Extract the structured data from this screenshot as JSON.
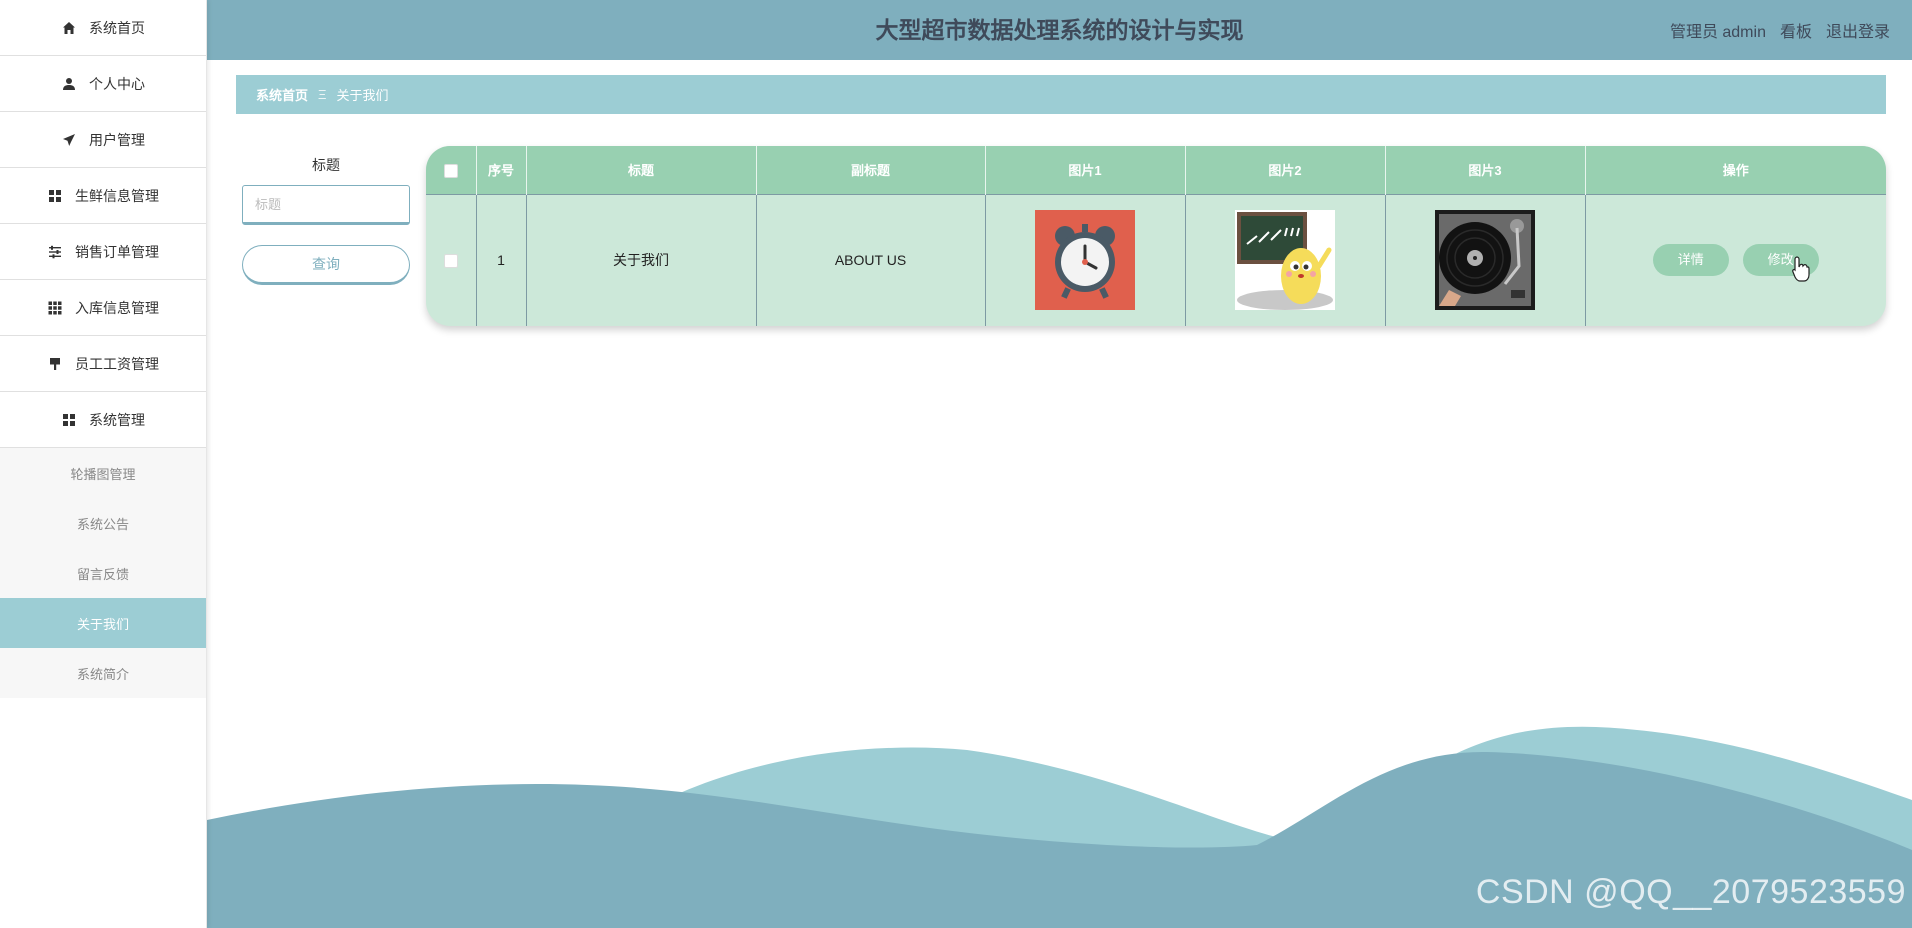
{
  "sidebar": {
    "items": [
      {
        "label": "系统首页",
        "icon": "home-icon"
      },
      {
        "label": "个人中心",
        "icon": "user-icon"
      },
      {
        "label": "用户管理",
        "icon": "send-icon"
      },
      {
        "label": "生鲜信息管理",
        "icon": "grid-icon"
      },
      {
        "label": "销售订单管理",
        "icon": "sliders-icon"
      },
      {
        "label": "入库信息管理",
        "icon": "apps-icon"
      },
      {
        "label": "员工工资管理",
        "icon": "brush-icon"
      },
      {
        "label": "系统管理",
        "icon": "grid-icon"
      }
    ],
    "submenu": [
      {
        "label": "轮播图管理",
        "active": false
      },
      {
        "label": "系统公告",
        "active": false
      },
      {
        "label": "留言反馈",
        "active": false
      },
      {
        "label": "关于我们",
        "active": true
      },
      {
        "label": "系统简介",
        "active": false
      }
    ]
  },
  "header": {
    "title": "大型超市数据处理系统的设计与实现",
    "user": "管理员 admin",
    "board": "看板",
    "logout": "退出登录"
  },
  "breadcrumb": {
    "home": "系统首页",
    "separator": "Ξ",
    "current": "关于我们"
  },
  "search": {
    "label": "标题",
    "placeholder": "标题",
    "value": "",
    "button": "查询"
  },
  "table": {
    "columns": [
      "序号",
      "标题",
      "副标题",
      "图片1",
      "图片2",
      "图片3",
      "操作"
    ],
    "rows": [
      {
        "index": "1",
        "title": "关于我们",
        "subtitle": "ABOUT US",
        "images": [
          "alarm-clock-image",
          "cartoon-chalkboard-image",
          "turntable-image"
        ]
      }
    ],
    "actions": {
      "detail": "详情",
      "edit": "修改"
    }
  },
  "colors": {
    "header": "#7fafbe",
    "breadcrumb": "#9ccdd4",
    "table_head": "#98d0b1",
    "table_body": "#cce8d9",
    "active_sub": "#9ccdd4"
  },
  "watermark": "CSDN @QQ__2079523559"
}
